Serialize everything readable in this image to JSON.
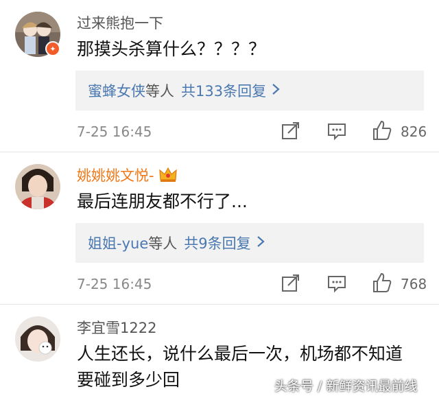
{
  "comments": [
    {
      "username": "过来熊抱一下",
      "text": "那摸头杀算什么？？？？",
      "reply_user": "蜜蜂女侠",
      "reply_mid": "等人",
      "reply_count": "共133条回复",
      "time": "7-25 16:45",
      "likes": "826"
    },
    {
      "username": "姚姚姚文悦-",
      "text": "最后连朋友都不行了...",
      "reply_user": "姐姐-yue",
      "reply_mid": "等人",
      "reply_count": "共9条回复",
      "time": "7-25 16:45",
      "likes": "768"
    },
    {
      "username": "李宜雪1222",
      "text_line1": "人生还长，说什么最后一次，机场都不知道",
      "text_line2": "要碰到多少回"
    }
  ],
  "watermark": "头条号 / 新鲜资讯最前线",
  "colors": {
    "link": "#4a78b0",
    "vip_name": "#f07818",
    "reply_bg": "#f2f2f2"
  }
}
